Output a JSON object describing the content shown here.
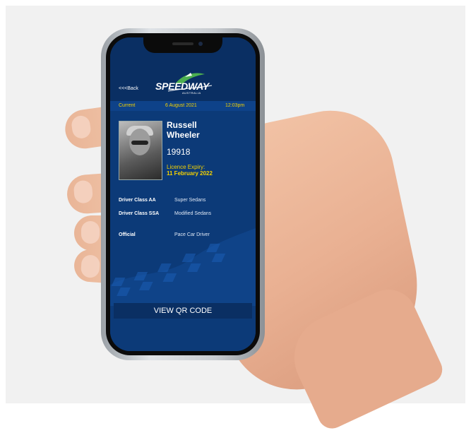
{
  "header": {
    "back_label": "<<<Back",
    "logo_text": "SPEEDWAY",
    "logo_sub": "AUSTRALIA"
  },
  "info_bar": {
    "status": "Current",
    "date": "6 August 2021",
    "time": "12:03pm"
  },
  "driver": {
    "first_name": "Russell",
    "last_name": "Wheeler",
    "number": "19918",
    "licence_label": "Licence Expiry:",
    "licence_expiry": "11 February 2022"
  },
  "classes": [
    {
      "label": "Driver Class AA",
      "value": "Super Sedans"
    },
    {
      "label": "Driver Class SSA",
      "value": "Modified Sedans"
    },
    {
      "label": "Official",
      "value": "Pace Car Driver"
    }
  ],
  "qr_button": "VIEW QR CODE",
  "colors": {
    "screen_bg": "#0c3a78",
    "header_bg": "#0a2f63",
    "accent": "#f5d200",
    "logo_green": "#4caf50"
  }
}
